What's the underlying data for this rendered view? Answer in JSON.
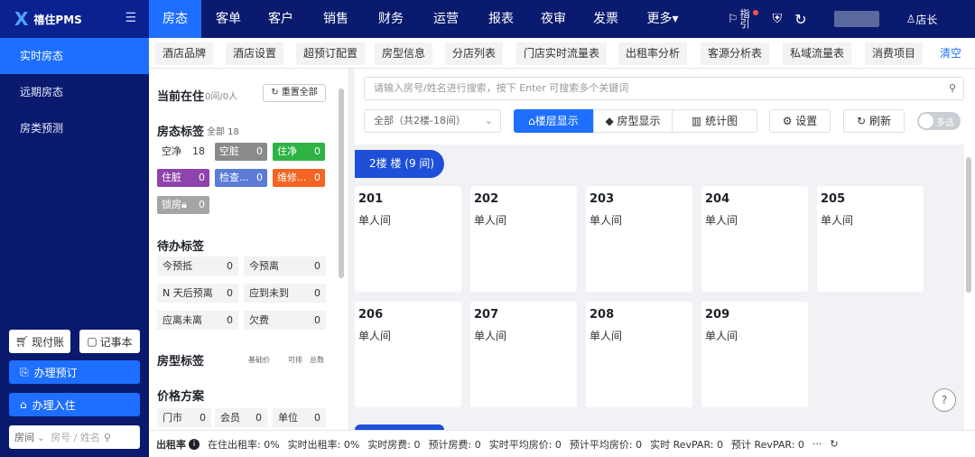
{
  "app": {
    "logo": "X",
    "name": "禧住PMS"
  },
  "topnav": [
    {
      "label": "房态"
    },
    {
      "label": "客单"
    },
    {
      "label": "客户"
    },
    {
      "label": "销售"
    },
    {
      "label": "财务"
    },
    {
      "label": "运营"
    },
    {
      "label": "报表"
    },
    {
      "label": "夜审"
    },
    {
      "label": "发票"
    },
    {
      "label": "更多▾"
    }
  ],
  "topright": {
    "guide": "指引",
    "user": "店长"
  },
  "sidebar": {
    "items": [
      {
        "label": "实时房态"
      },
      {
        "label": "远期房态"
      },
      {
        "label": "房类预测"
      }
    ],
    "cash": "现付账",
    "notebook": "记事本",
    "book": "办理预订",
    "checkin": "办理入住",
    "room_select": "房间",
    "room_placeholder": "房号 / 姓名"
  },
  "tabs": [
    {
      "label": "酒店品牌"
    },
    {
      "label": "酒店设置"
    },
    {
      "label": "超预订配置"
    },
    {
      "label": "房型信息"
    },
    {
      "label": "分店列表"
    },
    {
      "label": "门店实时流量表"
    },
    {
      "label": "出租率分析"
    },
    {
      "label": "客源分析表"
    },
    {
      "label": "私域流量表"
    },
    {
      "label": "消费项目"
    },
    {
      "label": "清空"
    }
  ],
  "left": {
    "current": "当前在住",
    "current_count": "0间/0人",
    "reset": "重置全部",
    "status_title": "房态标签",
    "status_total": "全部 18",
    "statuses": [
      {
        "label": "空净",
        "count": "18",
        "color": "#ffffff",
        "text": "#333333"
      },
      {
        "label": "空脏",
        "count": "0",
        "color": "#8a8a8a",
        "text": "#ffffff"
      },
      {
        "label": "住净",
        "count": "0",
        "color": "#2fb344",
        "text": "#ffffff"
      },
      {
        "label": "住脏",
        "count": "0",
        "color": "#8e44ad",
        "text": "#ffffff"
      },
      {
        "label": "检查...",
        "count": "0",
        "color": "#5b7bd5",
        "text": "#ffffff"
      },
      {
        "label": "维修...",
        "count": "0",
        "color": "#f26522",
        "text": "#ffffff"
      },
      {
        "label": "锁房",
        "count": "0",
        "color": "#a5a5a5",
        "text": "#ffffff"
      }
    ],
    "todo_title": "待办标签",
    "todos": [
      {
        "label": "今预抵",
        "count": "0"
      },
      {
        "label": "今预离",
        "count": "0"
      },
      {
        "label": "N 天后预离",
        "count": "0"
      },
      {
        "label": "应到未到",
        "count": "0"
      },
      {
        "label": "应离未离",
        "count": "0"
      },
      {
        "label": "欠费",
        "count": "0"
      }
    ],
    "roomtype_title": "房型标签",
    "roomtype_cols": [
      "基础价",
      "可排",
      "总数"
    ],
    "price_title": "价格方案",
    "prices": [
      {
        "label": "门市",
        "count": "0"
      },
      {
        "label": "会员",
        "count": "0"
      },
      {
        "label": "单位",
        "count": "0"
      }
    ]
  },
  "main": {
    "search_placeholder": "请输入房号/姓名进行搜索，按下 Enter 可搜索多个关键词",
    "floor_select": "全部（共2楼-18间）",
    "view_floor": "楼层显示",
    "view_type": "房型显示",
    "view_chart": "统计图",
    "settings": "设置",
    "refresh": "刷新",
    "multi": "多选",
    "floor_label": "2楼 楼 (9 间)",
    "rooms": [
      {
        "num": "201",
        "type": "单人间"
      },
      {
        "num": "202",
        "type": "单人间"
      },
      {
        "num": "203",
        "type": "单人间"
      },
      {
        "num": "204",
        "type": "单人间"
      },
      {
        "num": "205",
        "type": "单人间"
      },
      {
        "num": "206",
        "type": "单人间"
      },
      {
        "num": "207",
        "type": "单人间"
      },
      {
        "num": "208",
        "type": "单人间"
      },
      {
        "num": "209",
        "type": "单人间"
      }
    ],
    "help": "?"
  },
  "status": {
    "title": "出租率",
    "items": [
      "在住出租率: 0%",
      "实时出租率: 0%",
      "实时房费: 0",
      "预计房费: 0",
      "实时平均房价: 0",
      "预计平均房价: 0",
      "实时 RevPAR: 0",
      "预计 RevPAR: 0"
    ],
    "more": "···"
  },
  "colors": {
    "nav": "#0a1a6e",
    "accent": "#1e6fff",
    "canvas": "#f0f2f5"
  }
}
